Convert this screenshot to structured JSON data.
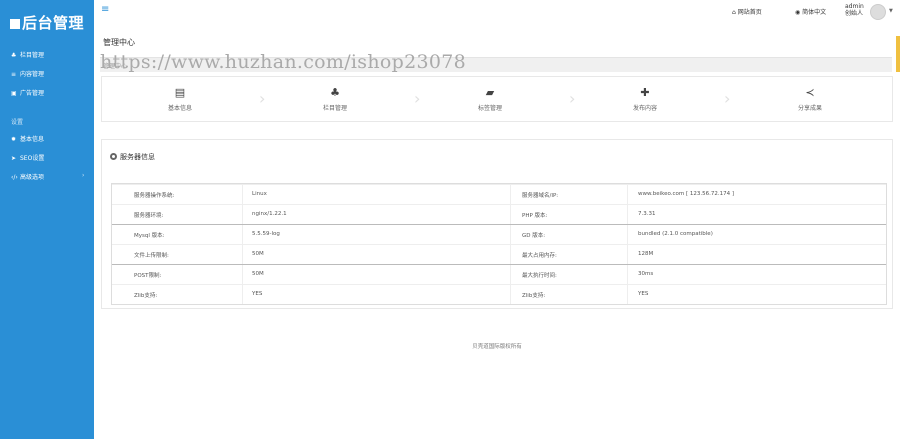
{
  "app": {
    "logo": "后台管理"
  },
  "sidebar": {
    "items": [
      {
        "icon": "sitemap-icon",
        "label": "栏目管理"
      },
      {
        "icon": "list-icon",
        "label": "内容管理"
      },
      {
        "icon": "image-icon",
        "label": "广告管理"
      }
    ],
    "group_label": "设置",
    "settings": [
      {
        "icon": "gear-icon",
        "label": "基本信息"
      },
      {
        "icon": "send-icon",
        "label": "SEO设置"
      },
      {
        "icon": "code-icon",
        "label": "高级选项"
      }
    ]
  },
  "topbar": {
    "home": "网站首页",
    "language": "简体中文",
    "user": "admin",
    "role": "创始人"
  },
  "page": {
    "title": "管理中心",
    "crumb": "管理中心",
    "watermark": "https://www.huzhan.com/ishop23078"
  },
  "quick_links": [
    {
      "icon": "card-icon",
      "label": "基本信息"
    },
    {
      "icon": "sitemap-icon",
      "label": "栏目管理"
    },
    {
      "icon": "folder-icon",
      "label": "标签管理"
    },
    {
      "icon": "plus-icon",
      "label": "发布内容"
    },
    {
      "icon": "share-icon",
      "label": "分享成果"
    }
  ],
  "server_info": {
    "heading": "服务器信息",
    "rows": [
      {
        "k1": "服务器操作系统:",
        "v1": "Linux",
        "k2": "服务器域名/IP:",
        "v2": "www.beikeo.com [ 123.56.72.174 ]"
      },
      {
        "k1": "服务器环境:",
        "v1": "nginx/1.22.1",
        "k2": "PHP 版本:",
        "v2": "7.3.31"
      },
      {
        "k1": "Mysql 版本:",
        "v1": "5.5.59-log",
        "k2": "GD 版本:",
        "v2": "bundled (2.1.0 compatible)"
      },
      {
        "k1": "文件上传限制:",
        "v1": "50M",
        "k2": "最大占用内存:",
        "v2": "128M"
      },
      {
        "k1": "POST限制:",
        "v1": "50M",
        "k2": "最大执行时间:",
        "v2": "30ms"
      },
      {
        "k1": "Zlib支持:",
        "v1": "YES",
        "k2": "Zlib支持:",
        "v2": "YES"
      }
    ]
  },
  "footer": {
    "text": "贝壳道国际版权所有"
  },
  "colors": {
    "sidebar": "#2a8fd6",
    "accent": "#2a8fd6"
  }
}
